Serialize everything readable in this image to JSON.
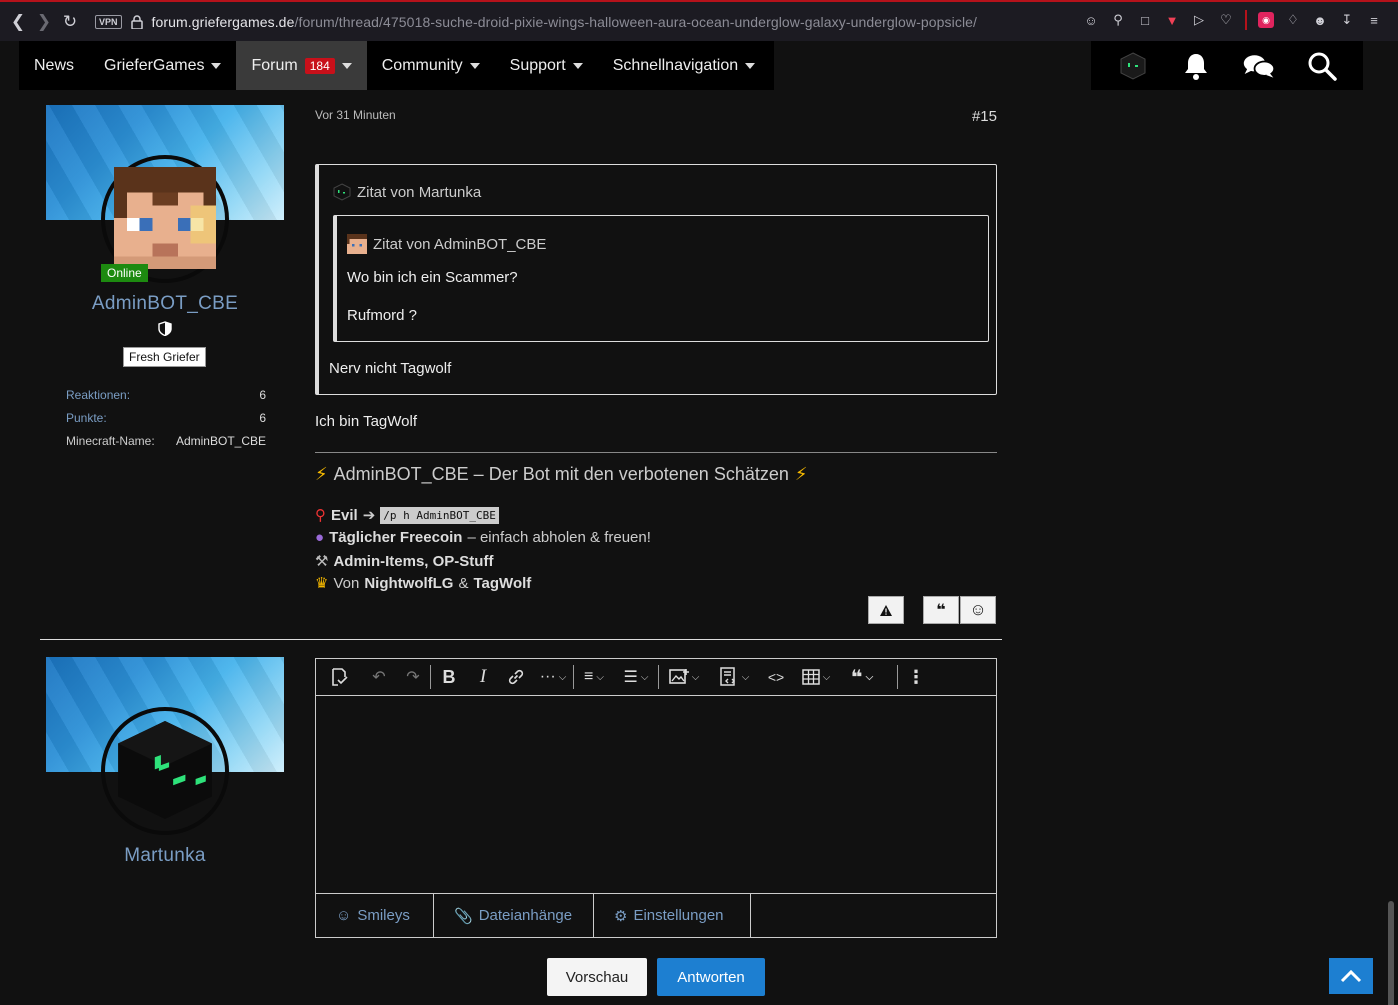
{
  "browser": {
    "vpn_label": "VPN",
    "url_host": "forum.griefergames.de",
    "url_path": "/forum/thread/475018-suche-droid-pixie-wings-halloween-aura-ocean-underglow-galaxy-underglow-popsicle/"
  },
  "nav": {
    "items": [
      {
        "label": "News"
      },
      {
        "label": "GrieferGames"
      },
      {
        "label": "Forum",
        "badge": "184"
      },
      {
        "label": "Community"
      },
      {
        "label": "Support"
      },
      {
        "label": "Schnellnavigation"
      }
    ]
  },
  "post": {
    "author": "AdminBOT_CBE",
    "status": "Online",
    "rank": "Fresh Griefer",
    "stats": [
      {
        "key": "Reaktionen:",
        "value": "6"
      },
      {
        "key": "Punkte:",
        "value": "6"
      },
      {
        "key": "Minecraft-Name:",
        "value": "AdminBOT_CBE"
      }
    ],
    "time": "Vor 31 Minuten",
    "number": "#15",
    "quote_outer_head": "Zitat von Martunka",
    "quote_inner_head": "Zitat von AdminBOT_CBE",
    "quote_inner_line1": "Wo bin ich ein Scammer?",
    "quote_inner_line2": "Rufmord ?",
    "quote_outer_text": "Nerv nicht Tagwolf",
    "text": "Ich bin TagWolf",
    "signature": {
      "title": "AdminBOT_CBE – Der Bot mit den verbotenen Schätzen",
      "line1_bold": "Evil",
      "line1_code": "/p h AdminBOT_CBE",
      "line2_bold": "Täglicher Freecoin",
      "line2_rest": "– einfach abholen & freuen!",
      "line3_bold": "Admin-Items, OP-Stuff",
      "line4_pre": "Von",
      "line4_b1": "NightwolfLG",
      "line4_mid": "&",
      "line4_b2": "TagWolf"
    }
  },
  "reply": {
    "author": "Martunka",
    "tabs": [
      {
        "label": "Smileys"
      },
      {
        "label": "Dateianhänge"
      },
      {
        "label": "Einstellungen"
      }
    ],
    "preview_label": "Vorschau",
    "submit_label": "Antworten"
  },
  "colors": {
    "accent": "#1d7fd1",
    "username": "#7a9dc4",
    "online": "#1d8a10",
    "badge": "#c8101a"
  }
}
